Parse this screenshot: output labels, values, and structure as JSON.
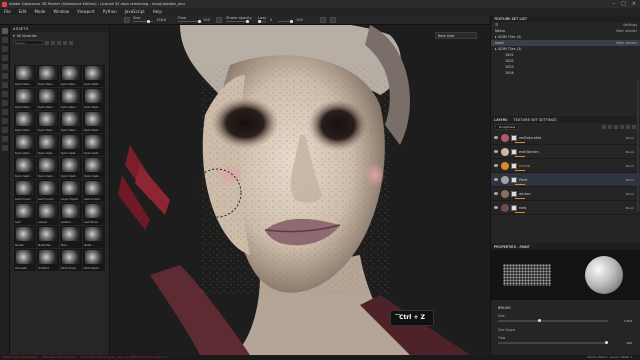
{
  "window": {
    "title": "Adobe Substance 3D Painter (Substance Edition) - License 32 days remaining - map(Updates_and",
    "controls": [
      "–",
      "□",
      "×"
    ]
  },
  "menu": [
    "File",
    "Edit",
    "Mode",
    "Window",
    "Viewport",
    "Python",
    "JavaScript",
    "Help"
  ],
  "toolbar": {
    "size_label": "Size",
    "size_value": "138.6",
    "flow_label": "Flow",
    "flow_value": "100",
    "stroke_opacity_label": "Stroke opacity",
    "spacing_label": "Lazy",
    "spacing_value": "0",
    "extra_value": "100"
  },
  "viewport": {
    "material_select": "Base color"
  },
  "assets": {
    "title": "ASSETS",
    "library": "All libraries",
    "search_placeholder": "Search",
    "items": [
      "Kyle's Real...",
      "Kyle's Real...",
      "Kyle's Real...",
      "Kyle's Real...",
      "Kyle's Real...",
      "Kyle's Real...",
      "Kyle's Real...",
      "Kyle's Real...",
      "Kyle's Real...",
      "Kyle's Real...",
      "Kyle's Real...",
      "Kyle's Real...",
      "Kyle's Real...",
      "Kyle's Spat...",
      "Kyle's Spat...",
      "Kyle's Spat...",
      "Kyle's Spat...",
      "Kyle's Spat...",
      "Kyle's Spat...",
      "Kyle's Spat...",
      "Leaf Curved",
      "Leaf Curved",
      "Layer Impact",
      "Leaf Curved",
      "Leaf",
      "Leaves",
      "Leather",
      "Leaf Stone",
      "Marker",
      "Metal Ble...",
      "Met...",
      "Metal...",
      "Oil Leaks",
      "Oil Paint",
      "Paint Drops",
      "Paint Splat..."
    ]
  },
  "texture_set_list": {
    "title": "TEXTURE SET LIST",
    "settings_label": "Settings",
    "rows": [
      {
        "name": "Nekro",
        "right": "Main shader"
      },
      {
        "name": "▸ UDIM Tiles (0)",
        "right": ""
      },
      {
        "name": "head",
        "right": "Main shader"
      },
      {
        "name": "▸ UDIM Tiles (3)",
        "right": ""
      },
      {
        "name": "1001",
        "right": ""
      },
      {
        "name": "1002",
        "right": ""
      },
      {
        "name": "1003",
        "right": ""
      },
      {
        "name": "1004",
        "right": ""
      }
    ]
  },
  "layers": {
    "tabs": [
      "LAYERS",
      "TEXTURE SET SETTINGS"
    ],
    "channel_select": "Roughness",
    "rows": [
      {
        "name": "redSaturated",
        "blend": "Norm",
        "value": "100"
      },
      {
        "name": "everDarken",
        "blend": "Norm",
        "value": "100"
      },
      {
        "name": "Hocesi",
        "blend": "Norm",
        "value": "100"
      },
      {
        "name": "Paint",
        "blend": "Norm",
        "value": "100"
      },
      {
        "name": "darken",
        "blend": "Norm",
        "value": "100"
      },
      {
        "name": "reds",
        "blend": "Norm",
        "value": "100"
      }
    ]
  },
  "properties": {
    "title": "PROPERTIES - PAINT",
    "brush_title": "BRUSH",
    "size_label": "Size",
    "size_value": "1.654",
    "size_space_label": "Size Space",
    "flow_label": "Flow",
    "flow_value": "100"
  },
  "shortcut_overlay": "Ctrl + Z",
  "status": {
    "message": "[GPU] Layer Bake(Mode) ... (UV) Bake layer (quality) ... paint layer has UV issue, clean up UDIM tile for this mesh (0.0)",
    "right_text": "Device 3Dtex 1 Lance   |   VRAM: 1 ..."
  },
  "colors": {
    "accent_selection": "#3a3f4c",
    "status_error": "#b33333",
    "orange_mask": "#d98a2f"
  }
}
